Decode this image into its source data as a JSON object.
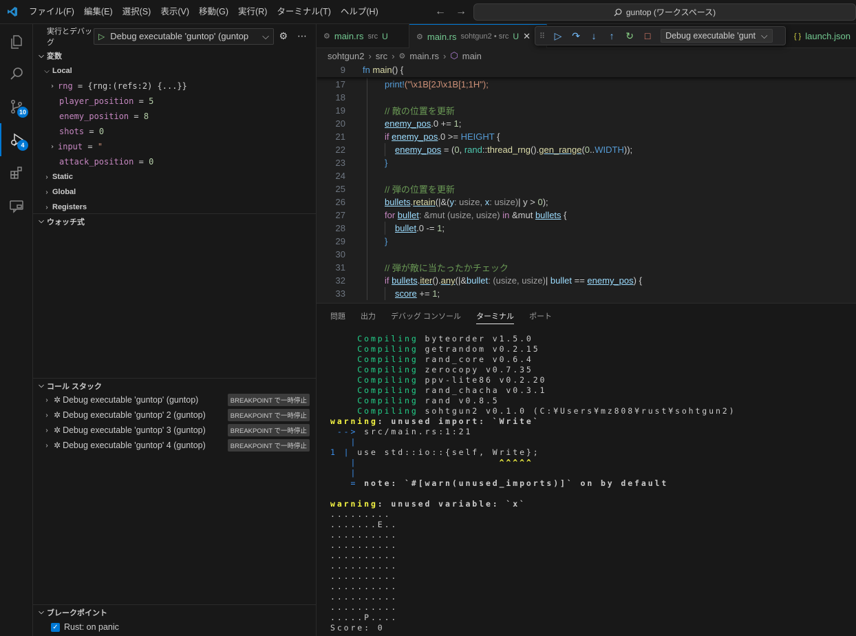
{
  "titlebar": {
    "menu": [
      "ファイル(F)",
      "編集(E)",
      "選択(S)",
      "表示(V)",
      "移動(G)",
      "実行(R)",
      "ターミナル(T)",
      "ヘルプ(H)"
    ],
    "search_text": "guntop (ワークスペース)"
  },
  "activity": {
    "source_control_badge": "10",
    "debug_badge": "4"
  },
  "run": {
    "title": "実行とデバッグ",
    "config": "Debug executable 'guntop' (guntop"
  },
  "variables": {
    "header": "変数",
    "local_label": "Local",
    "items": [
      {
        "name": "rng",
        "value": "{rng:(refs:2) {...}}",
        "expandable": true
      },
      {
        "name": "player_position",
        "value": "5",
        "expandable": false
      },
      {
        "name": "enemy_position",
        "value": "8",
        "expandable": false
      },
      {
        "name": "shots",
        "value": "0",
        "expandable": false
      },
      {
        "name": "input",
        "value": "\"",
        "expandable": true
      },
      {
        "name": "attack_position",
        "value": "0",
        "expandable": false
      }
    ],
    "scopes": [
      "Static",
      "Global",
      "Registers"
    ]
  },
  "watch": {
    "header": "ウォッチ式"
  },
  "callstack": {
    "header": "コール スタック",
    "items": [
      {
        "name": "Debug executable 'guntop' (guntop)",
        "status": "BREAKPOINT で一時停止"
      },
      {
        "name": "Debug executable 'guntop' 2 (guntop)",
        "status": "BREAKPOINT で一時停止"
      },
      {
        "name": "Debug executable 'guntop' 3 (guntop)",
        "status": "BREAKPOINT で一時停止"
      },
      {
        "name": "Debug executable 'guntop' 4 (guntop)",
        "status": "BREAKPOINT で一時停止"
      }
    ]
  },
  "breakpoints": {
    "header": "ブレークポイント",
    "items": [
      {
        "label": "Rust: on panic",
        "checked": true
      }
    ]
  },
  "tabs": [
    {
      "name": "main.rs",
      "desc": "src",
      "status": "U",
      "active": false
    },
    {
      "name": "main.rs",
      "desc": "sohtgun2 • src",
      "status": "U",
      "active": true
    }
  ],
  "launch_tab": {
    "name": "launch.json",
    "icon": "{ }"
  },
  "debug_toolbar": {
    "config": "Debug executable 'gunt"
  },
  "breadcrumb": [
    "sohtgun2",
    "src",
    "main.rs",
    "main"
  ],
  "sticky": {
    "ln": "9",
    "code": "fn main() {"
  },
  "code": {
    "l17": {
      "ln": "17",
      "mac": "print!",
      "s": "(\"\\x1B[2J\\x1B[1;1H\");"
    },
    "l18": {
      "ln": "18"
    },
    "l19": {
      "ln": "19",
      "c": "// 敵の位置を更新"
    },
    "l20": {
      "ln": "20",
      "v": "enemy_pos",
      "r": ".0 += ",
      "n": "1",
      "e": ";"
    },
    "l21": {
      "ln": "21",
      "k": "if ",
      "v": "enemy_pos",
      "r": ".0 >= ",
      "h": "HEIGHT",
      "e": " {"
    },
    "l22": {
      "ln": "22",
      "v": "enemy_pos",
      "r": " = (",
      "n": "0",
      "r2": ", ",
      "t": "rand",
      "r3": "::",
      "f": "thread_rng",
      "r4": "().",
      "f2": "gen_range",
      "r5": "(",
      "n2": "0",
      "r6": "..",
      "h": "WIDTH",
      "e": "));"
    },
    "l23": {
      "ln": "23",
      "e": "}"
    },
    "l24": {
      "ln": "24"
    },
    "l25": {
      "ln": "25",
      "c": "// 弾の位置を更新"
    },
    "l26": {
      "ln": "26",
      "v": "bullets",
      "r": ".",
      "f": "retain",
      "r2": "(|&(",
      "v2": "y",
      "hint": ": usize, ",
      "v3": "x",
      "hint2": ": usize)",
      "r3": "| y > ",
      "n": "0",
      "e": ");"
    },
    "l27": {
      "ln": "27",
      "k": "for ",
      "v": "bullet",
      "hint": ": &mut (usize, usize)",
      "k2": " in ",
      "r": "&mut ",
      "v2": "bullets",
      "e": " {"
    },
    "l28": {
      "ln": "28",
      "v": "bullet",
      "r": ".0 -= ",
      "n": "1",
      "e": ";"
    },
    "l29": {
      "ln": "29",
      "e": "}"
    },
    "l30": {
      "ln": "30"
    },
    "l31": {
      "ln": "31",
      "c": "// 弾が敵に当たったかチェック"
    },
    "l32": {
      "ln": "32",
      "k": "if ",
      "v": "bullets",
      "r": ".",
      "f": "iter",
      "r2": "().",
      "f2": "any",
      "r3": "(|&",
      "v2": "bullet",
      "hint": ": (usize, usize)",
      "r4": "| ",
      "v3": "bullet",
      "r5": " == ",
      "v4": "enemy_pos",
      "e": ") {"
    },
    "l33": {
      "ln": "33",
      "v": "score",
      "r": " += ",
      "n": "1",
      "e": ";"
    }
  },
  "panel": {
    "tabs": [
      "問題",
      "出力",
      "デバッグ コンソール",
      "ターミナル",
      "ポート"
    ],
    "active_tab": "ターミナル"
  },
  "terminal": {
    "compiling": [
      {
        "word": "Compiling",
        "rest": " byteorder v1.5.0"
      },
      {
        "word": "Compiling",
        "rest": " getrandom v0.2.15"
      },
      {
        "word": "Compiling",
        "rest": " rand_core v0.6.4"
      },
      {
        "word": "Compiling",
        "rest": " zerocopy v0.7.35"
      },
      {
        "word": "Compiling",
        "rest": " ppv-lite86 v0.2.20"
      },
      {
        "word": "Compiling",
        "rest": " rand_chacha v0.3.1"
      },
      {
        "word": "Compiling",
        "rest": " rand v0.8.5"
      },
      {
        "word": "Compiling",
        "rest": " sohtgun2 v0.1.0 (C:¥Users¥mz808¥rust¥sohtgun2)"
      }
    ],
    "warn1": {
      "label": "warning",
      "msg": ": unused import: `Write`"
    },
    "arrow": "-->",
    "loc": " src/main.rs:1:21",
    "pipe": "|",
    "src_ln": "1",
    "src_code": " use std::io::{self, Write};",
    "carets": "^^^^^",
    "note_eq": "=",
    "note": " note: `#[warn(unused_imports)]` on by default",
    "warn2": {
      "label": "warning",
      "msg": ": unused variable: `x`"
    },
    "grid": [
      ".........",
      ".......E..",
      "..........",
      "..........",
      "..........",
      "..........",
      "..........",
      "..........",
      "..........",
      "..........",
      ".....P....",
      "Score: 0"
    ]
  }
}
